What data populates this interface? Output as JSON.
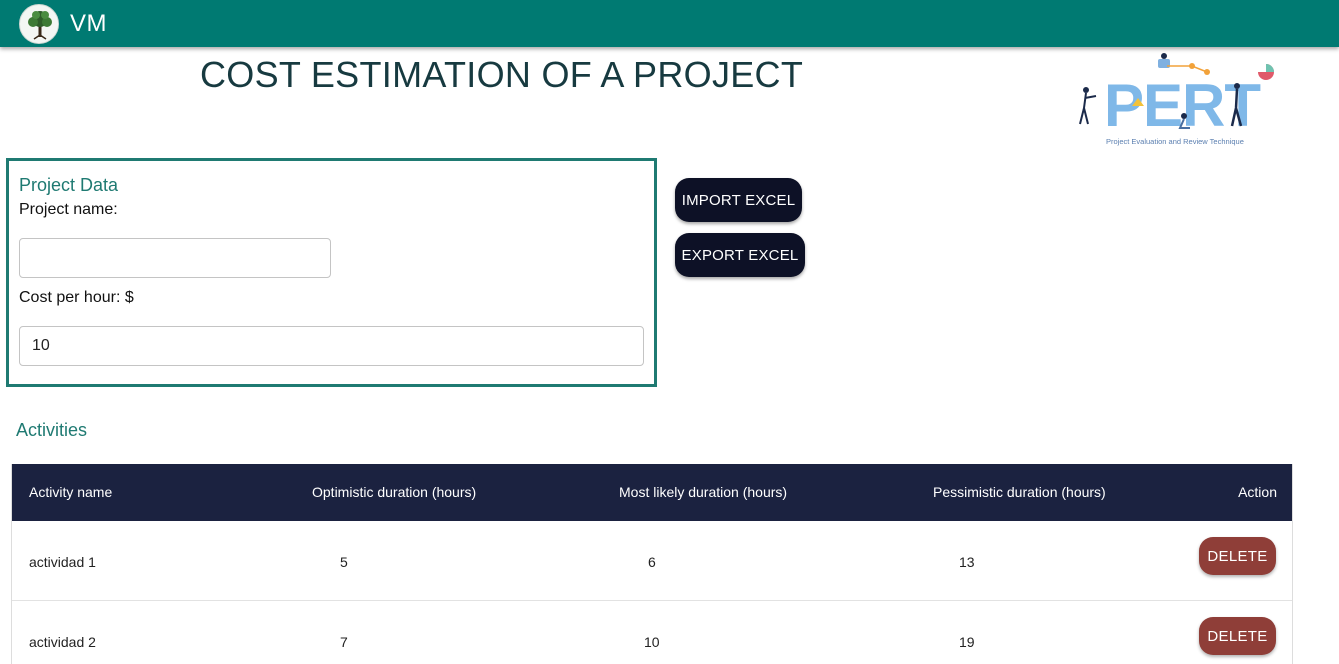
{
  "appbar": {
    "brand": "VM"
  },
  "page": {
    "title": "COST ESTIMATION OF A PROJECT"
  },
  "pert_logo": {
    "word": "PERT",
    "caption": "Project Evaluation and Review Technique"
  },
  "project_card": {
    "title": "Project Data",
    "name_label": "Project name:",
    "name_value": "",
    "cost_label": "Cost per hour: $",
    "cost_value": "10"
  },
  "actions": {
    "import_label": "IMPORT EXCEL",
    "export_label": "EXPORT EXCEL"
  },
  "activities": {
    "title": "Activities",
    "columns": {
      "name": "Activity name",
      "optimistic": "Optimistic duration (hours)",
      "most_likely": "Most likely duration (hours)",
      "pessimistic": "Pessimistic duration (hours)",
      "action": "Action"
    },
    "rows": [
      {
        "name": "actividad 1",
        "optimistic": "5",
        "most_likely": "6",
        "pessimistic": "13",
        "action_label": "DELETE"
      },
      {
        "name": "actividad 2",
        "optimistic": "7",
        "most_likely": "10",
        "pessimistic": "19",
        "action_label": "DELETE"
      }
    ]
  },
  "colors": {
    "appbar": "#007a72",
    "accent": "#1f7a72",
    "dark_button": "#0d1126",
    "table_header": "#1b2240",
    "delete_button": "#8f3e38"
  },
  "icons": {
    "logo": "tree-logo-icon"
  }
}
